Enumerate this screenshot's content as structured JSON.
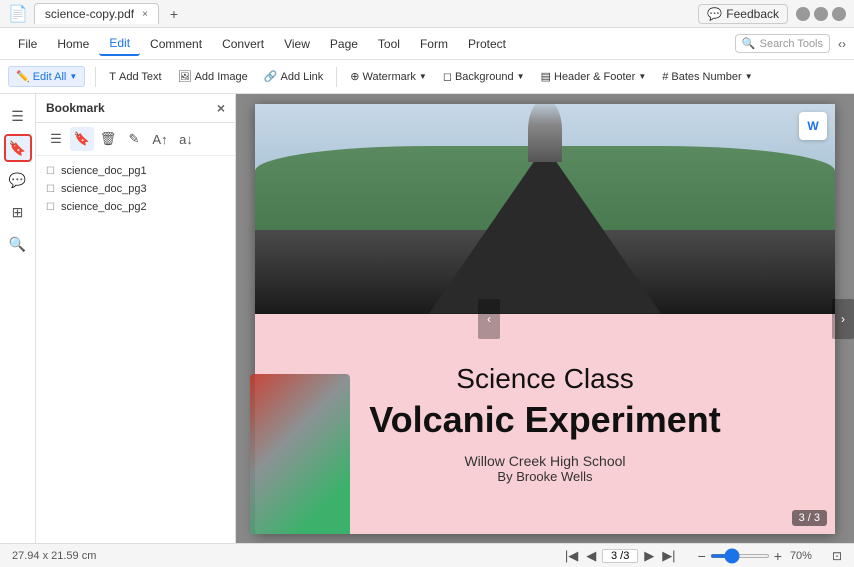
{
  "titlebar": {
    "app_icon": "📄",
    "tab_title": "science-copy.pdf",
    "close_tab": "×",
    "new_tab": "+",
    "feedback_label": "Feedback",
    "minimize": "—",
    "maximize": "□",
    "close_win": "×"
  },
  "menubar": {
    "items": [
      {
        "label": "File",
        "active": false
      },
      {
        "label": "Home",
        "active": false
      },
      {
        "label": "Edit",
        "active": true
      },
      {
        "label": "Comment",
        "active": false
      },
      {
        "label": "Convert",
        "active": false
      },
      {
        "label": "View",
        "active": false
      },
      {
        "label": "Page",
        "active": false
      },
      {
        "label": "Tool",
        "active": false
      },
      {
        "label": "Form",
        "active": false
      },
      {
        "label": "Protect",
        "active": false
      }
    ],
    "search_placeholder": "Search Tools"
  },
  "toolbar": {
    "edit_all": "Edit All",
    "add_text": "Add Text",
    "add_image": "Add Image",
    "add_link": "Add Link",
    "watermark": "Watermark",
    "background": "Background",
    "header_footer": "Header & Footer",
    "bates_number": "Bates Number"
  },
  "sidebar": {
    "icons": [
      {
        "name": "hamburger",
        "symbol": "☰",
        "active": false
      },
      {
        "name": "bookmark",
        "symbol": "🔖",
        "active": true
      },
      {
        "name": "comment",
        "symbol": "💬",
        "active": false
      },
      {
        "name": "pages",
        "symbol": "⊞",
        "active": false
      },
      {
        "name": "search",
        "symbol": "🔍",
        "active": false
      }
    ]
  },
  "bookmark": {
    "title": "Bookmark",
    "items": [
      {
        "label": "science_doc_pg1"
      },
      {
        "label": "science_doc_pg3"
      },
      {
        "label": "science_doc_pg2"
      }
    ]
  },
  "pdf": {
    "title1": "Science Class",
    "title2": "Volcanic Experiment",
    "school": "Willow Creek High School",
    "author": "By Brooke Wells",
    "page_badge": "3 / 3"
  },
  "statusbar": {
    "dimensions": "27.94 x 21.59 cm",
    "page_current": "3",
    "page_total": "3",
    "page_display": "3 /3",
    "zoom_level": "70%"
  }
}
